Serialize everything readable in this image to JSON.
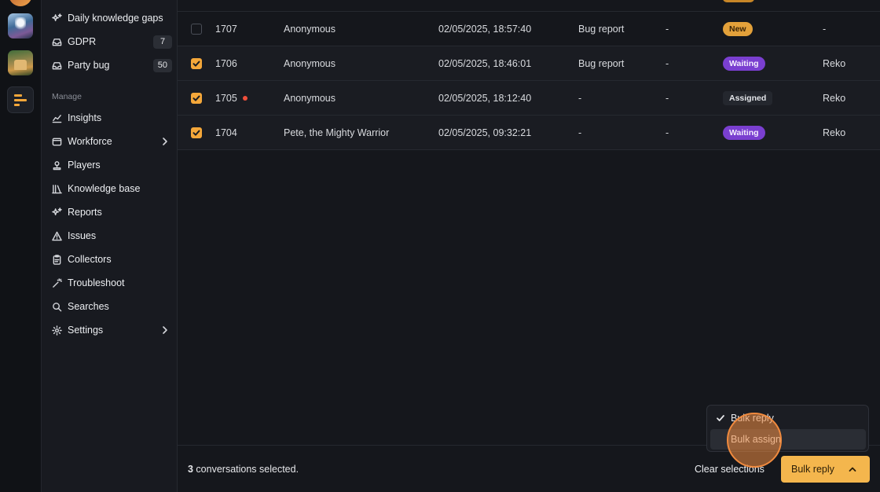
{
  "sidebar": {
    "items_top": [
      {
        "label": "Daily knowledge gaps",
        "icon": "sparkles-icon"
      },
      {
        "label": "GDPR",
        "icon": "inbox-icon",
        "count": "7"
      },
      {
        "label": "Party bug",
        "icon": "inbox-icon",
        "count": "50"
      }
    ],
    "section_manage": "Manage",
    "items_manage": [
      {
        "label": "Insights",
        "icon": "chart-icon"
      },
      {
        "label": "Workforce",
        "icon": "window-icon"
      },
      {
        "label": "Players",
        "icon": "user-icon"
      },
      {
        "label": "Knowledge base",
        "icon": "library-icon"
      },
      {
        "label": "Reports",
        "icon": "sparkles-icon"
      },
      {
        "label": "Issues",
        "icon": "warning-icon"
      },
      {
        "label": "Collectors",
        "icon": "clipboard-icon"
      },
      {
        "label": "Troubleshoot",
        "icon": "wand-icon"
      },
      {
        "label": "Searches",
        "icon": "search-icon"
      },
      {
        "label": "Settings",
        "icon": "gear-icon"
      }
    ]
  },
  "table": {
    "rows": [
      {
        "id": "1707",
        "player": "Anonymous",
        "date": "02/05/2025, 18:57:40",
        "type": "Bug report",
        "col5": "-",
        "status": "New",
        "agent": "-",
        "selected": false,
        "unread": false
      },
      {
        "id": "1706",
        "player": "Anonymous",
        "date": "02/05/2025, 18:46:01",
        "type": "Bug report",
        "col5": "-",
        "status": "Waiting",
        "agent": "Reko",
        "selected": true,
        "unread": false
      },
      {
        "id": "1705",
        "player": "Anonymous",
        "date": "02/05/2025, 18:12:40",
        "type": "-",
        "col5": "-",
        "status": "Assigned",
        "agent": "Reko",
        "selected": true,
        "unread": true
      },
      {
        "id": "1704",
        "player": "Pete, the Mighty Warrior",
        "date": "02/05/2025, 09:32:21",
        "type": "-",
        "col5": "-",
        "status": "Waiting",
        "agent": "Reko",
        "selected": true,
        "unread": false
      }
    ]
  },
  "footer": {
    "selected_count": "3",
    "selected_suffix": " conversations selected.",
    "clear_label": "Clear selections",
    "bulk_label": "Bulk reply"
  },
  "bulk_menu": {
    "options": [
      "Bulk reply",
      "Bulk assign"
    ],
    "checked": "Bulk reply",
    "hovered": "Bulk assign"
  },
  "colors": {
    "accent": "#f4a73a",
    "new_pill": "#e3a13a",
    "waiting_pill": "#7a3fd0",
    "unread_dot": "#f04f3b"
  }
}
